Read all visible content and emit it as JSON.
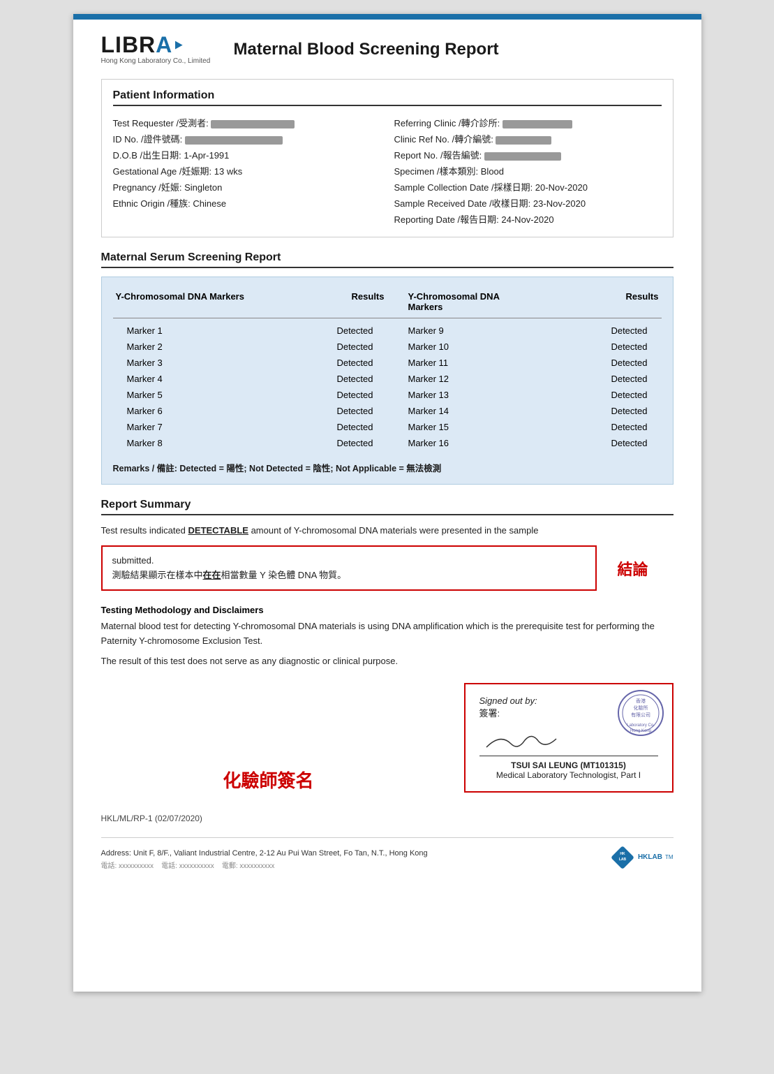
{
  "header": {
    "logo_text": "LIBRA",
    "logo_subtitle": "Hong Kong Laboratory Co., Limited",
    "report_title": "Maternal Blood Screening Report"
  },
  "patient_info": {
    "section_heading": "Patient Information",
    "left_fields": [
      {
        "label": "Test Requester /受測者:",
        "value": "REDACTED_LONG"
      },
      {
        "label": "ID No. /證件號碼:",
        "value": "REDACTED_LONG"
      },
      {
        "label": "D.O.B /出生日期:",
        "value": "1-Apr-1991"
      },
      {
        "label": "Gestational Age /妊娠期:",
        "value": "13 wks"
      },
      {
        "label": "Pregnancy /妊娠:",
        "value": "Singleton"
      },
      {
        "label": "Ethnic Origin /種族:",
        "value": "Chinese"
      }
    ],
    "right_fields": [
      {
        "label": "Referring Clinic /轉介診所:",
        "value": "REDACTED_LONG"
      },
      {
        "label": "Clinic Ref No. /轉介編號:",
        "value": "REDACTED_SHORT"
      },
      {
        "label": "Report No. /報告編號:",
        "value": "REDACTED_MED"
      },
      {
        "label": "Specimen /樣本類別:",
        "value": "Blood"
      },
      {
        "label": "Sample Collection Date /採樣日期:",
        "value": "20-Nov-2020"
      },
      {
        "label": "Sample Received Date /收樣日期:",
        "value": "23-Nov-2020"
      },
      {
        "label": "Reporting Date /報告日期:",
        "value": "24-Nov-2020"
      }
    ]
  },
  "serum_section": {
    "heading": "Maternal Serum Screening Report",
    "col_headers": [
      "Y-Chromosomal DNA Markers",
      "Results",
      "Y-Chromosomal DNA Markers",
      "Results"
    ],
    "left_markers": [
      {
        "name": "Marker 1",
        "result": "Detected"
      },
      {
        "name": "Marker 2",
        "result": "Detected"
      },
      {
        "name": "Marker 3",
        "result": "Detected"
      },
      {
        "name": "Marker 4",
        "result": "Detected"
      },
      {
        "name": "Marker 5",
        "result": "Detected"
      },
      {
        "name": "Marker 6",
        "result": "Detected"
      },
      {
        "name": "Marker 7",
        "result": "Detected"
      },
      {
        "name": "Marker 8",
        "result": "Detected"
      }
    ],
    "right_markers": [
      {
        "name": "Marker 9",
        "result": "Detected"
      },
      {
        "name": "Marker 10",
        "result": "Detected"
      },
      {
        "name": "Marker 11",
        "result": "Detected"
      },
      {
        "name": "Marker 12",
        "result": "Detected"
      },
      {
        "name": "Marker 13",
        "result": "Detected"
      },
      {
        "name": "Marker 14",
        "result": "Detected"
      },
      {
        "name": "Marker 15",
        "result": "Detected"
      },
      {
        "name": "Marker 16",
        "result": "Detected"
      }
    ],
    "remarks": "Remarks / 備註: Detected = 陽性; Not Detected = 陰性; Not Applicable = 無法檢測"
  },
  "report_summary": {
    "heading": "Report Summary",
    "summary_line1": "Test results indicated ",
    "summary_detectable": "DETECTABLE",
    "summary_line2": " amount of Y-chromosomal DNA materials were presented in the sample",
    "submitted_text": "submitted.",
    "chinese_result": "測驗結果顯示在樣本中在在相當數量 Y 染色體 DNA 物質。",
    "conclusion_label": "結論"
  },
  "methodology": {
    "heading": "Testing Methodology and Disclaimers",
    "text1": "Maternal blood test for detecting Y-chromosomal DNA materials is using DNA amplification which is the prerequisite test for performing the Paternity Y-chromosome Exclusion Test.",
    "text2": "The result of this test does not serve as any diagnostic or clinical purpose."
  },
  "signature": {
    "chemist_label": "化驗師簽名",
    "signed_out_by": "Signed out by:",
    "signed_out_by_chinese": "簽署:",
    "signatory_name": "TSUI SAI LEUNG (MT101315)",
    "signatory_title": "Medical Laboratory Technologist, Part I"
  },
  "footer": {
    "ref": "HKL/ML/RP-1 (02/07/2020)",
    "address": "Address: Unit F, 8/F., Valiant Industrial Centre, 2-12 Au Pui Wan Street, Fo Tan, N.T., Hong Kong",
    "hklab_label": "HKLAB"
  }
}
